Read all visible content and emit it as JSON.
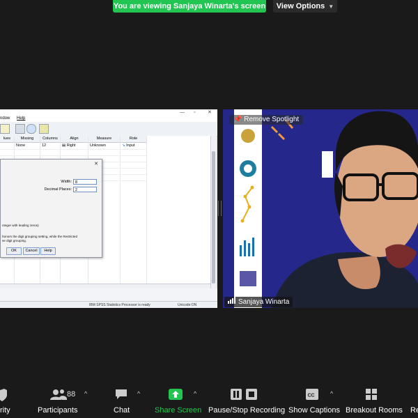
{
  "banner": {
    "text": "You are viewing Sanjaya Winarta's screen",
    "view_options": "View Options"
  },
  "spss": {
    "menu": [
      "ndow",
      "Help"
    ],
    "columns": [
      "lues",
      "Missing",
      "Columns",
      "Align",
      "Measure",
      "Role"
    ],
    "row1": {
      "missing": "None",
      "columns": "12",
      "align": "Right",
      "measure": "Unknown",
      "role": "Input"
    },
    "status_processor": "IBM SPSS Statistics Processor is ready",
    "status_unicode": "Unicode:ON"
  },
  "dialog": {
    "width_label": "Width:",
    "width_value": "8",
    "decimal_label": "Decimal Places:",
    "decimal_value": "2",
    "note1": "nteger with leading zeros)",
    "note2": "honors the digit grouping setting, while the Restricted",
    "note3": "se digit grouping.",
    "ok": "OK",
    "cancel": "Cancel",
    "help": "Help"
  },
  "video": {
    "remove_spotlight": "Remove Spotlight",
    "participant_name": "Sanjaya Winarta"
  },
  "toolbar": {
    "security": "rity",
    "participants": "Participants",
    "participants_count": "88",
    "chat": "Chat",
    "share_screen": "Share Screen",
    "recording": "Pause/Stop Recording",
    "captions": "Show Captions",
    "breakout": "Breakout Rooms",
    "reactions": "Re"
  },
  "colors": {
    "accent_green": "#23c552",
    "video_bg": "#25288a"
  }
}
